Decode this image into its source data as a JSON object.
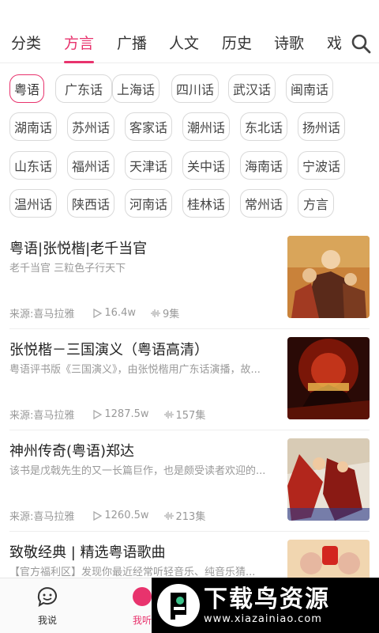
{
  "tabs": [
    {
      "label": "分类",
      "active": false
    },
    {
      "label": "方言",
      "active": true
    },
    {
      "label": "广播",
      "active": false
    },
    {
      "label": "人文",
      "active": false
    },
    {
      "label": "历史",
      "active": false
    },
    {
      "label": "诗歌",
      "active": false
    },
    {
      "label": "戏",
      "active": false
    }
  ],
  "search_icon": "search-icon",
  "dialects": [
    "粤语",
    "广东话",
    "上海话",
    "四川话",
    "武汉话",
    "闽南话",
    "湖南话",
    "苏州话",
    "客家话",
    "潮州话",
    "东北话",
    "扬州话",
    "山东话",
    "福州话",
    "天津话",
    "关中话",
    "海南话",
    "宁波话",
    "温州话",
    "陕西话",
    "河南话",
    "桂林话",
    "常州话",
    "方言"
  ],
  "selected_dialect": "粤语",
  "programs": [
    {
      "title": "粤语|张悦楷|老千当官",
      "desc": "老千当官 三粒色子行天下",
      "source": "来源:喜马拉雅",
      "plays": "16.4w",
      "episodes": "9集"
    },
    {
      "title": "张悦楷－三国演义（粤语高清）",
      "desc": "粤语评书版《三国演义》，由张悦楷用广东话演播，故...",
      "source": "来源:喜马拉雅",
      "plays": "1287.5w",
      "episodes": "157集"
    },
    {
      "title": "神州传奇(粤语)郑达",
      "desc": "该书是戊戟先生的又一长篇巨作，也是颇受读者欢迎的...",
      "source": "来源:喜马拉雅",
      "plays": "1260.5w",
      "episodes": "213集"
    },
    {
      "title": "致敬经典 | 精选粤语歌曲",
      "desc": "【官方福利区】发现你最近经常听轻音乐、纯音乐猜...",
      "source": "",
      "plays": "",
      "episodes": ""
    }
  ],
  "bottom_nav": [
    {
      "label": "我说",
      "icon": "chat-face-icon",
      "active": false
    },
    {
      "label": "我听",
      "icon": "listen-icon",
      "active": true
    }
  ],
  "watermark": {
    "title": "下载鸟资源",
    "url": "www.xiazainiao.com"
  },
  "colors": {
    "accent": "#e8336d",
    "text": "#333333",
    "muted": "#999999",
    "border": "#d9d9d9"
  }
}
